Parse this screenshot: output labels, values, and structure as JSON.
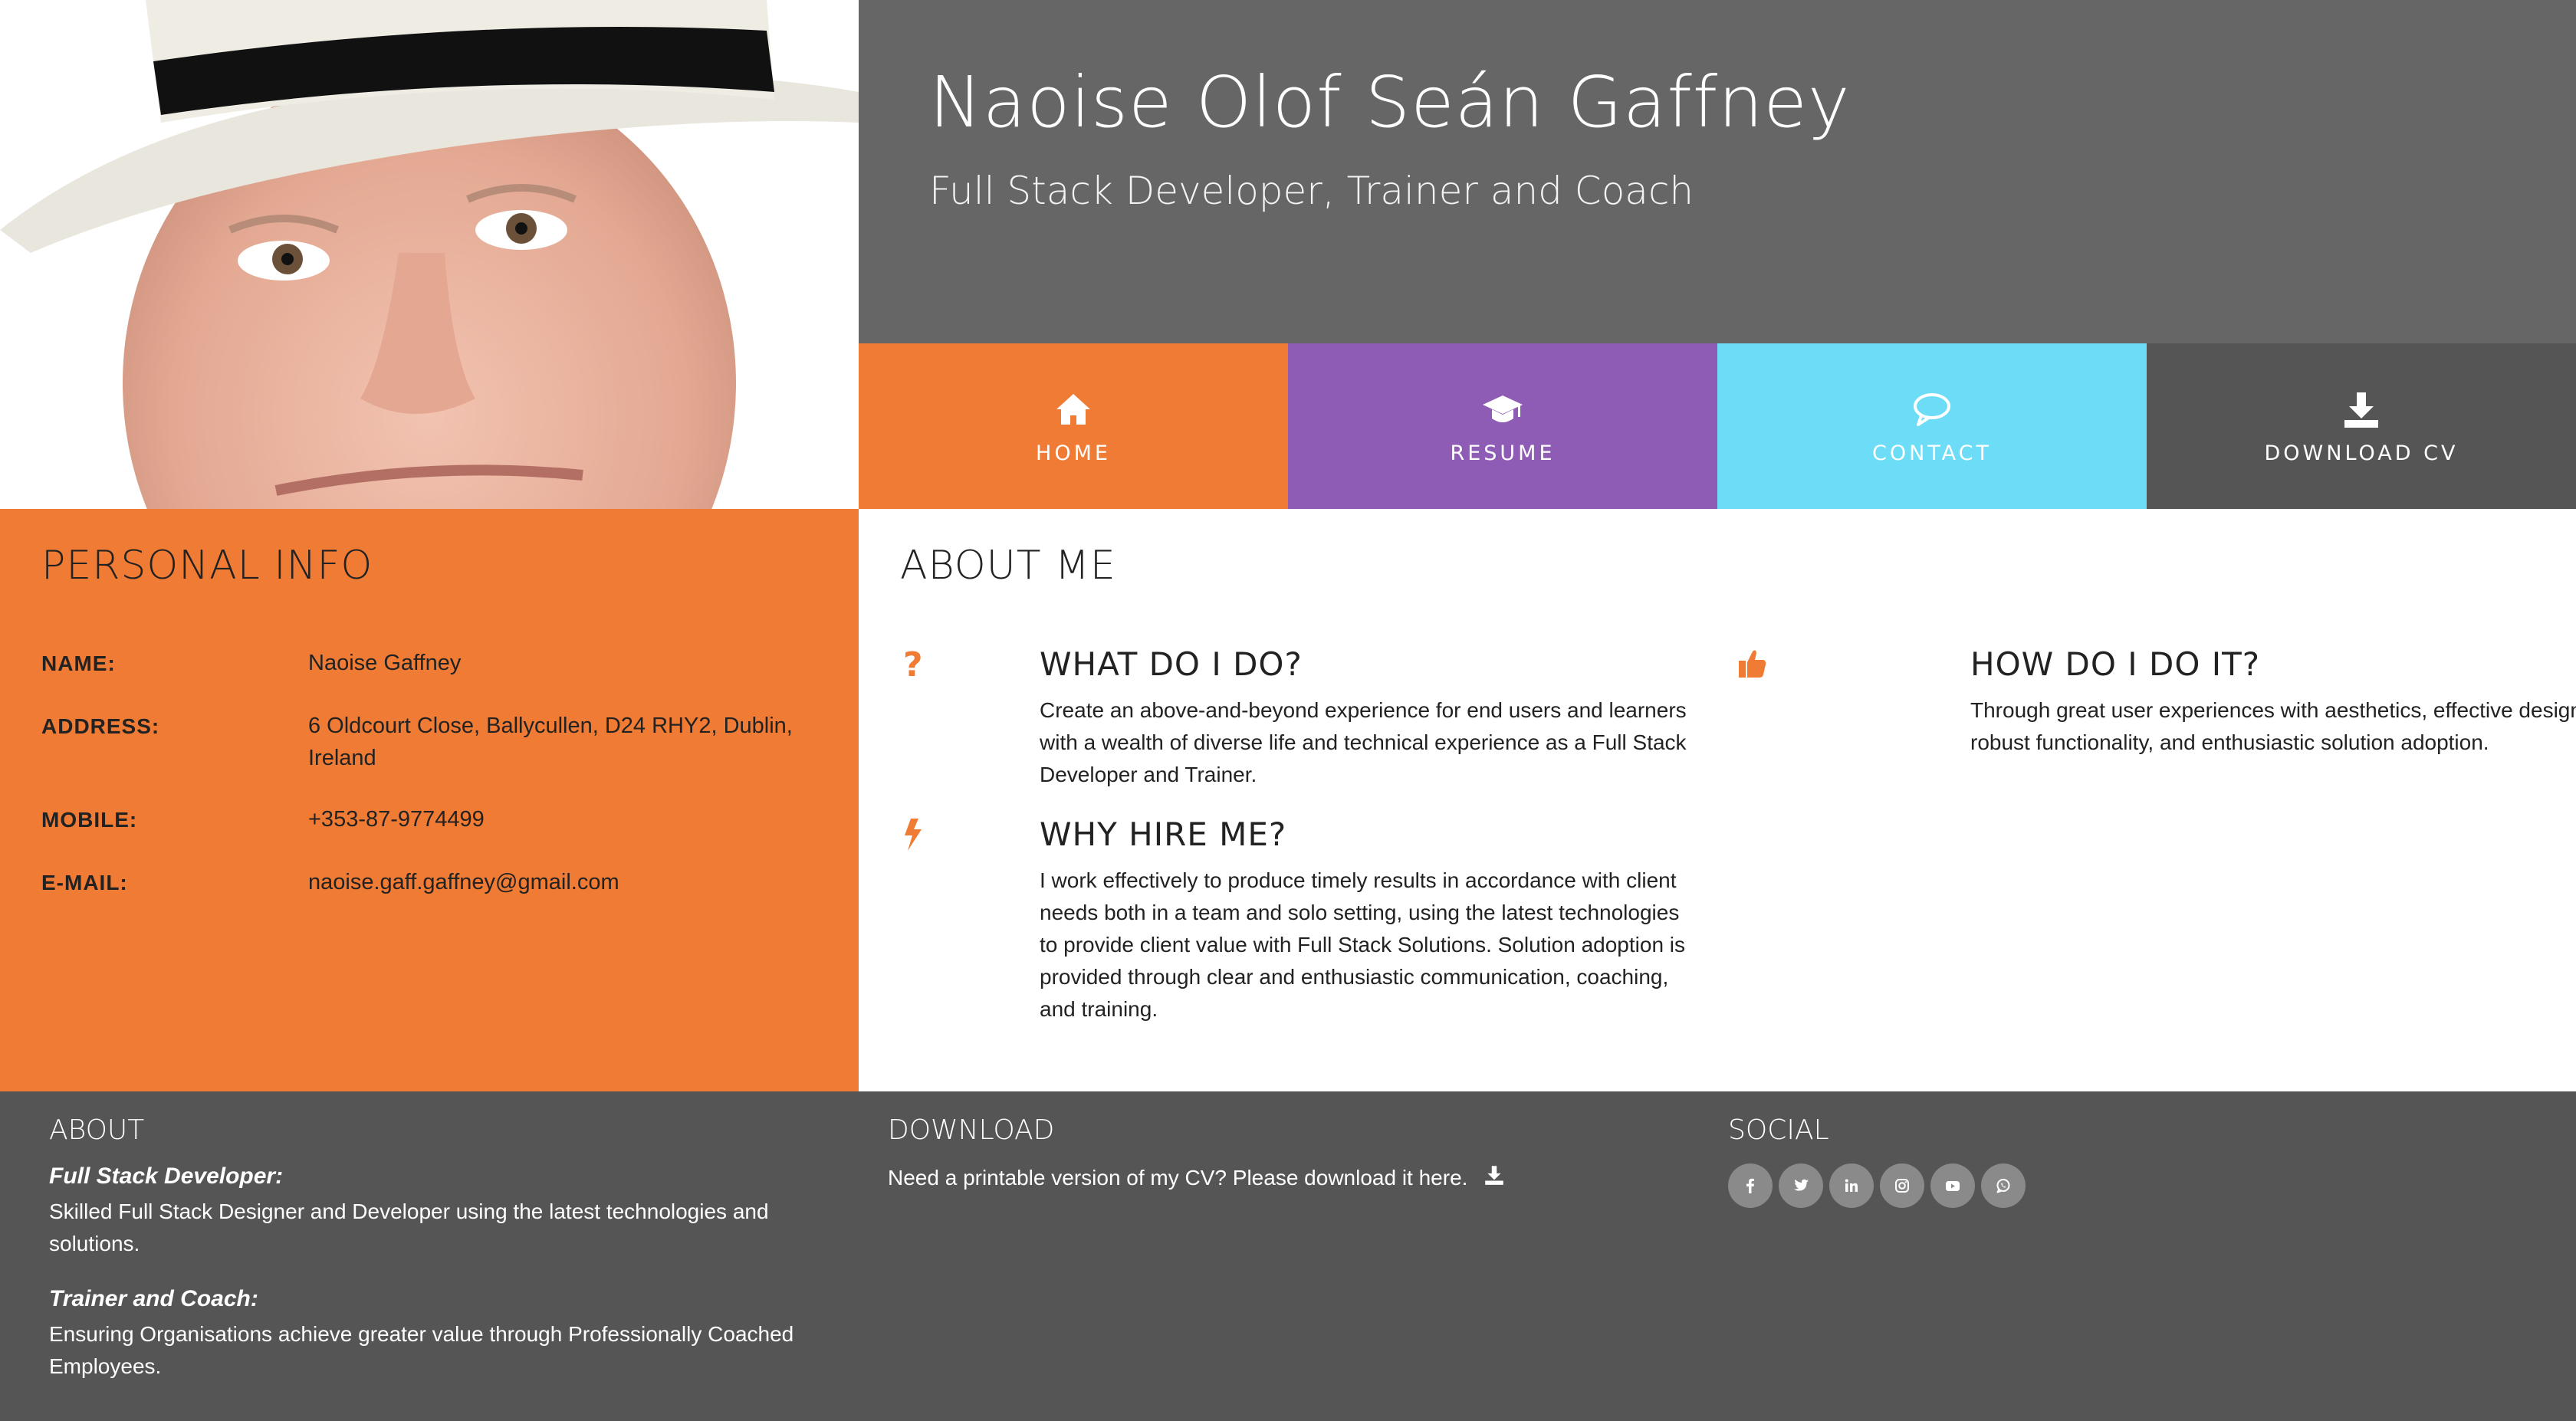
{
  "header": {
    "name": "Naoise Olof Seán Gaffney",
    "subtitle": "Full Stack Developer, Trainer and Coach"
  },
  "nav": {
    "items": [
      {
        "label": "HOME",
        "icon": "home-icon",
        "color": "#ef7b35"
      },
      {
        "label": "RESUME",
        "icon": "graduation-cap-icon",
        "color": "#8e5cb5"
      },
      {
        "label": "CONTACT",
        "icon": "chat-bubble-icon",
        "color": "#6cdcf7"
      },
      {
        "label": "DOWNLOAD CV",
        "icon": "download-icon",
        "color": "#555555"
      }
    ]
  },
  "personal": {
    "title": "PERSONAL INFO",
    "rows": [
      {
        "key": "NAME:",
        "value": "Naoise Gaffney"
      },
      {
        "key": "ADDRESS:",
        "value": "6 Oldcourt Close, Ballycullen, D24 RHY2, Dublin, Ireland"
      },
      {
        "key": "MOBILE:",
        "value": "+353-87-9774499"
      },
      {
        "key": "E-MAIL:",
        "value": "naoise.gaff.gaffney@gmail.com"
      }
    ]
  },
  "about": {
    "title": "ABOUT ME",
    "blocks": [
      {
        "icon": "question-icon",
        "heading": "WHAT DO I DO?",
        "text": "Create an above-and-beyond experience for end users and learners with a wealth of diverse life and technical experience as a Full Stack Developer and Trainer."
      },
      {
        "icon": "lightning-icon",
        "heading": "WHY HIRE ME?",
        "text": "I work effectively to produce timely results in accordance with client needs both in a team and solo setting, using the latest technologies to provide client value with Full Stack Solutions. Solution adoption is provided through clear and enthusiastic communication, coaching, and training."
      },
      {
        "icon": "thumbs-up-icon",
        "heading": "HOW DO I DO IT?",
        "text": "Through great user experiences with aesthetics, effective design, robust functionality, and enthusiastic solution adoption."
      }
    ]
  },
  "footer": {
    "about": {
      "title": "ABOUT",
      "role1": "Full Stack Developer:",
      "role1_text": "Skilled Full Stack Designer and Developer using the latest technologies and solutions.",
      "role2": "Trainer and Coach:",
      "role2_text": "Ensuring Organisations achieve greater value through Professionally Coached Employees."
    },
    "download": {
      "title": "DOWNLOAD",
      "text": "Need a printable version of my CV? Please download it here."
    },
    "social": {
      "title": "SOCIAL",
      "icons": [
        "facebook-icon",
        "twitter-icon",
        "linkedin-icon",
        "instagram-icon",
        "youtube-icon",
        "whatsapp-icon"
      ]
    }
  },
  "colors": {
    "accent": "#ef7b35",
    "purple": "#8e5cb5",
    "cyan": "#6cdcf7",
    "dark": "#555555",
    "header": "#666666"
  }
}
